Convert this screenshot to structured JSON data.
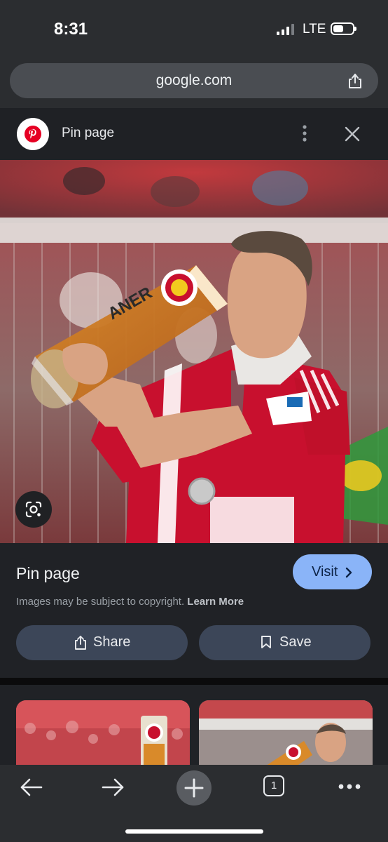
{
  "status": {
    "time": "8:31",
    "network": "LTE"
  },
  "browser": {
    "url": "google.com"
  },
  "viewer": {
    "source_title": "Pin page"
  },
  "info": {
    "title": "Pin page",
    "visit_label": "Visit",
    "copyright_text": "Images may be subject to copyright.",
    "learn_more": "Learn More",
    "share_label": "Share",
    "save_label": "Save"
  },
  "image_text": {
    "glass_text": "ANER"
  },
  "toolbar": {
    "tab_count": "1"
  },
  "colors": {
    "accent": "#8ab4f8",
    "pinterest": "#e60023",
    "jersey": "#c8102e"
  },
  "icons": [
    "share-icon",
    "more-vert-icon",
    "close-icon",
    "lens-icon",
    "chevron-right-icon",
    "bookmark-icon",
    "back-arrow-icon",
    "forward-arrow-icon",
    "plus-icon",
    "more-horiz-icon"
  ]
}
